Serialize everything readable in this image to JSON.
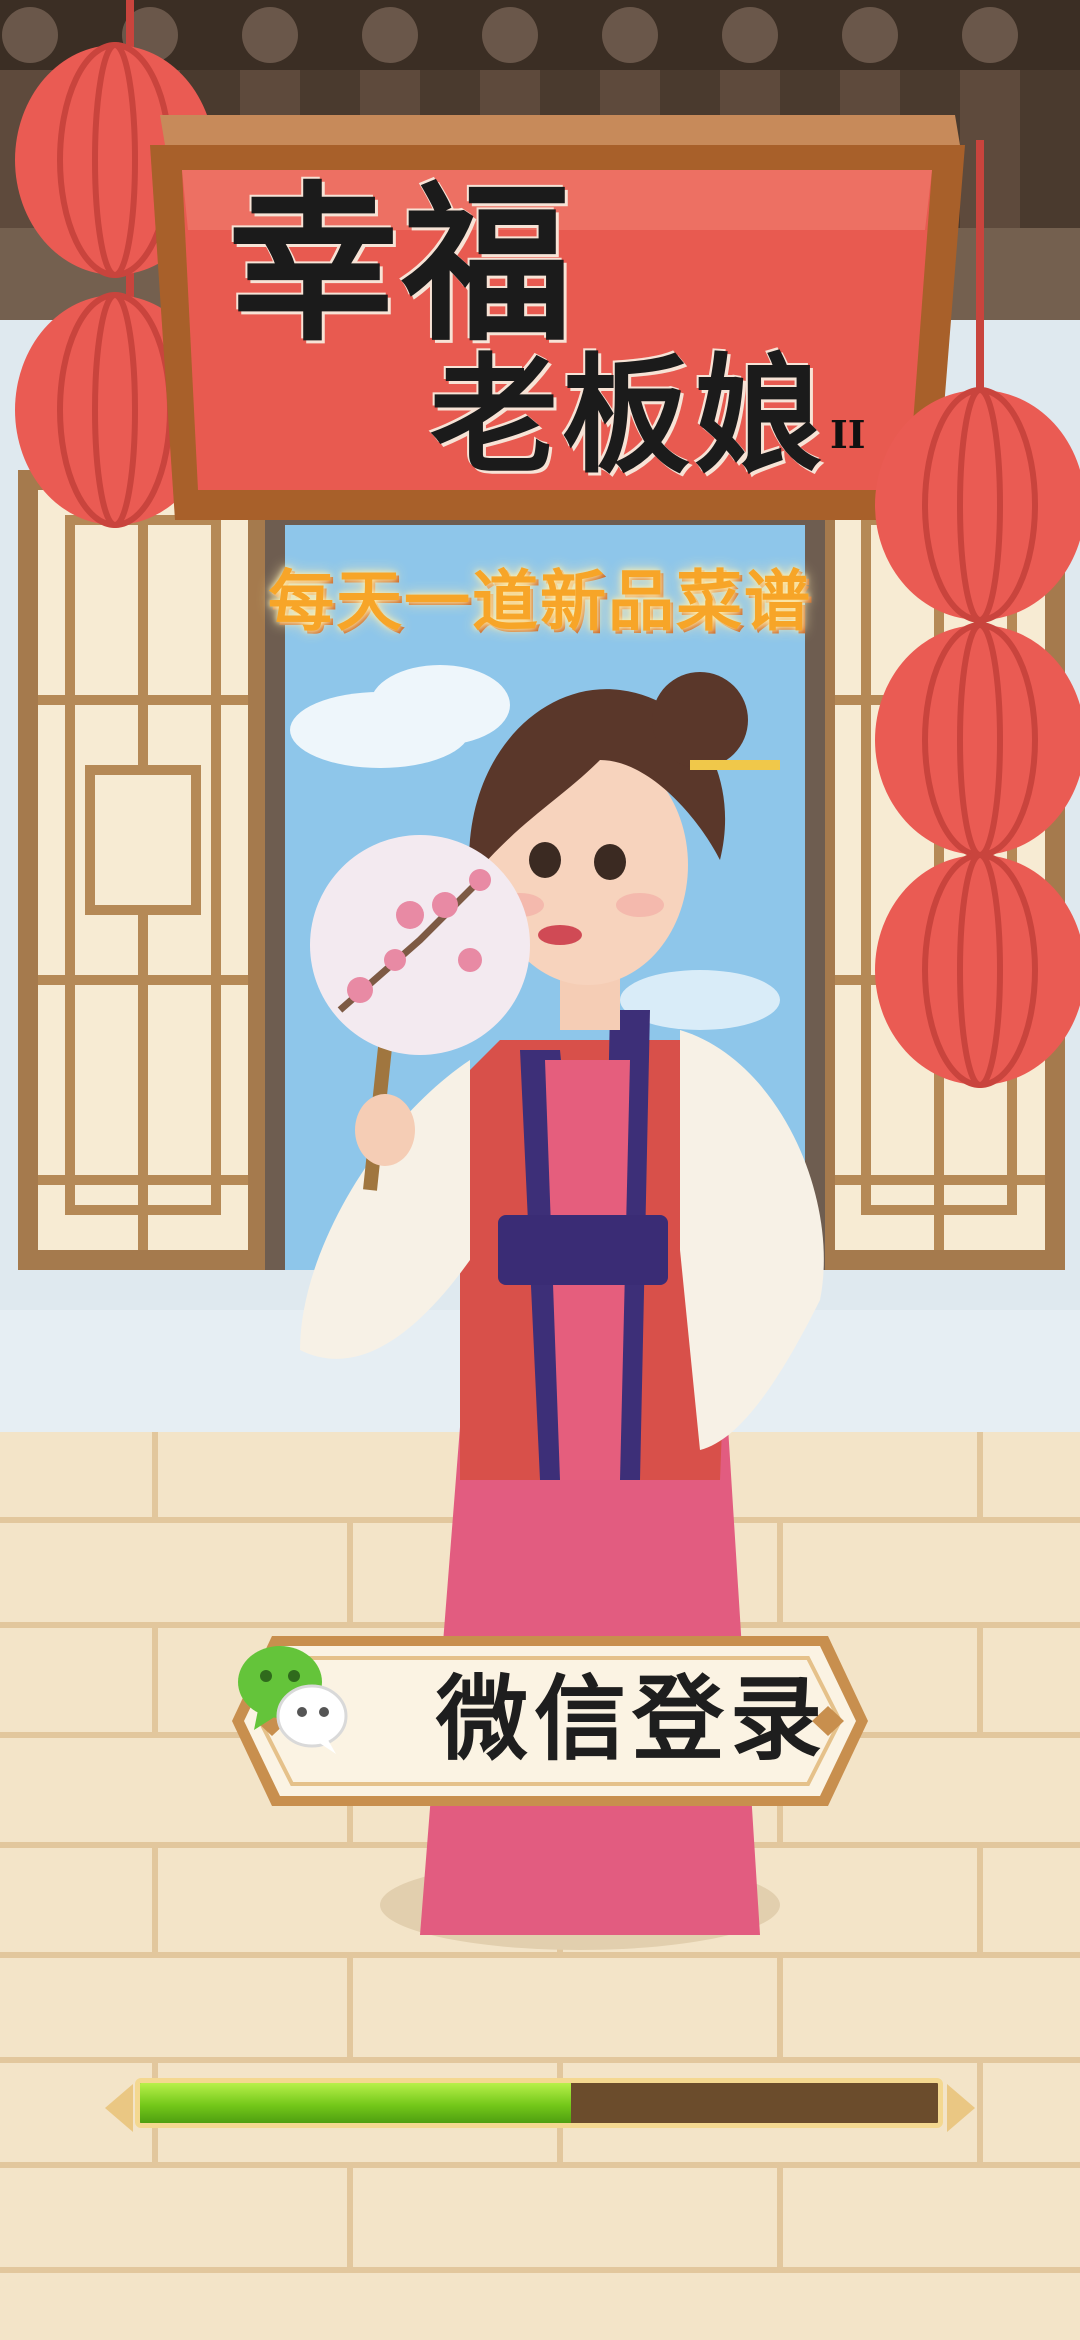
{
  "title": {
    "line1": "幸福",
    "line2": "老板娘",
    "suffix": "II"
  },
  "tagline": "每天一道新品菜谱",
  "login_button": {
    "label": "微信登录",
    "icon": "wechat-icon"
  },
  "loading": {
    "progress": 0.54
  },
  "colors": {
    "sign_red": "#e85a50",
    "sign_wood": "#a8602a",
    "lantern": "#ea5b53",
    "progress_green": "#7ccc1f",
    "floor": "#f3e4c8"
  }
}
